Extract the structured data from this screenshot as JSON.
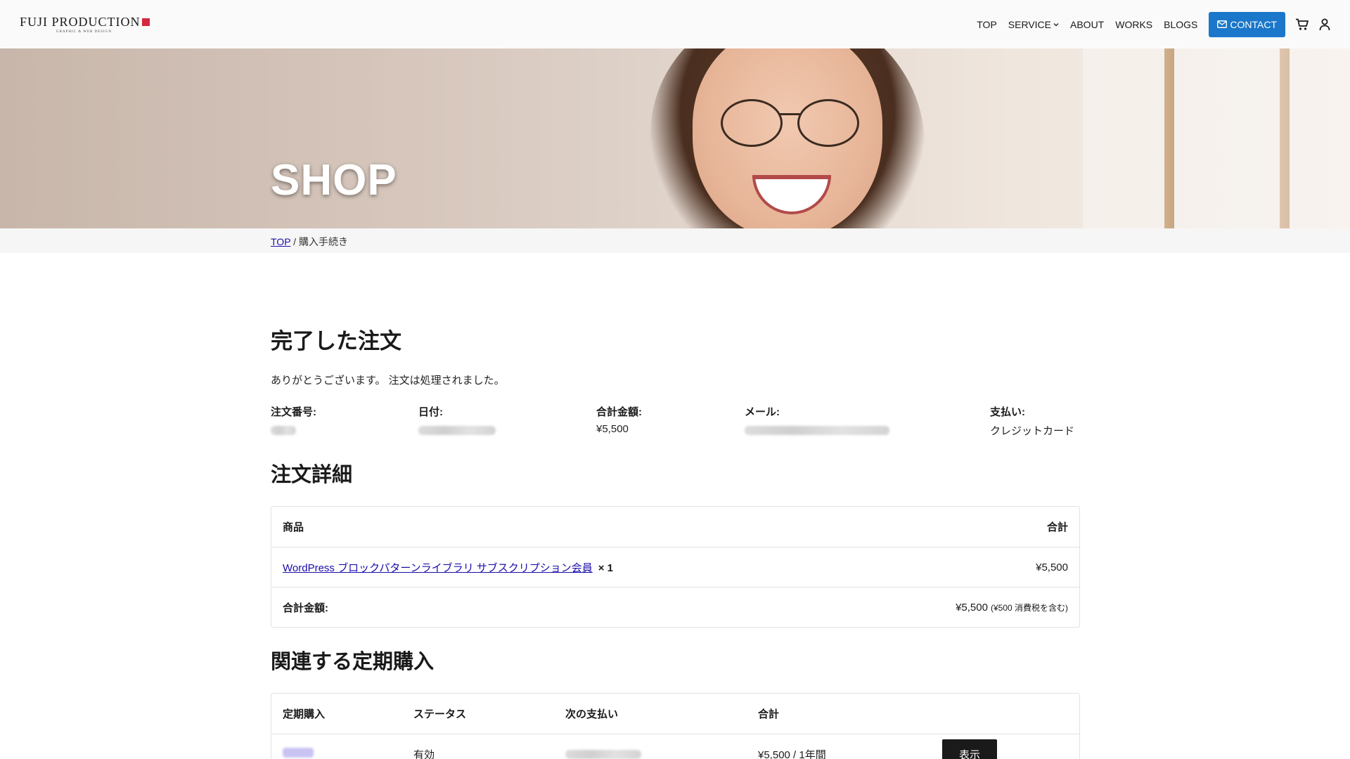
{
  "header": {
    "logo_text": "FUJI PRODUCTION",
    "logo_subtext": "GRAPHIC & WEB DESIGN",
    "nav": [
      {
        "label": "TOP"
      },
      {
        "label": "SERVICE"
      },
      {
        "label": "ABOUT"
      },
      {
        "label": "WORKS"
      },
      {
        "label": "BLOGS"
      }
    ],
    "contact_label": "CONTACT",
    "accent_color": "#1a77c9",
    "icons": [
      "mail-icon",
      "cart-icon",
      "user-icon",
      "chevron-down-icon"
    ]
  },
  "hero": {
    "title": "SHOP"
  },
  "breadcrumb": {
    "home": "TOP",
    "separator": "/",
    "current": "購入手続き"
  },
  "order": {
    "heading": "完了した注文",
    "thanks": "ありがとうございます。 注文は処理されました。",
    "overview": {
      "order_number_label": "注文番号:",
      "date_label": "日付:",
      "total_label": "合計金額:",
      "total_value": "¥5,500",
      "email_label": "メール:",
      "payment_label": "支払い:",
      "payment_value": "クレジットカード"
    }
  },
  "details": {
    "heading": "注文詳細",
    "col_product": "商品",
    "col_total": "合計",
    "item_name": "WordPress ブロックパターンライブラリ サブスクリプション会員",
    "item_qty": "× 1",
    "item_total": "¥5,500",
    "sum_label": "合計金額:",
    "sum_value": "¥5,500",
    "sum_tax": "(¥500 消費税を含む)"
  },
  "subscriptions": {
    "heading": "関連する定期購入",
    "col_subscription": "定期購入",
    "col_status": "ステータス",
    "col_next_payment": "次の支払い",
    "col_total": "合計",
    "status": "有効",
    "total": "¥5,500 / 1年間",
    "view_label": "表示"
  }
}
